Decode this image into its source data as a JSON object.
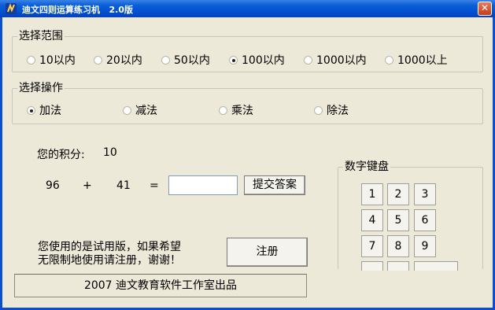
{
  "window": {
    "title": "迪文四则运算练习机   2.0版",
    "close_glyph": "✕"
  },
  "range_group": {
    "label": "选择范围",
    "options": [
      "10以内",
      "20以内",
      "50以内",
      "100以内",
      "1000以内",
      "1000以上"
    ],
    "selected": "100以内"
  },
  "op_group": {
    "label": "选择操作",
    "options": [
      "加法",
      "减法",
      "乘法",
      "除法"
    ],
    "selected": "加法"
  },
  "score": {
    "label": "您的积分:",
    "value": "10"
  },
  "problem": {
    "a": "96",
    "op": "+",
    "b": "41",
    "eq": "=",
    "answer": ""
  },
  "submit_label": "提交答案",
  "trial_notice": {
    "line1": "您使用的是试用版，如果希望",
    "line2": "无限制地使用请注册，谢谢！"
  },
  "register_label": "注册",
  "keypad": {
    "label": "数字键盘",
    "keys": [
      "1",
      "2",
      "3",
      "4",
      "5",
      "6",
      "7",
      "8",
      "9"
    ]
  },
  "footer": "2007 迪文教育软件工作室出品",
  "icons": {
    "app": "app-icon",
    "close": "close-icon"
  },
  "colors": {
    "titlebar": "#0050d0",
    "window_bg": "#ece9d8",
    "close": "#c43c16"
  }
}
